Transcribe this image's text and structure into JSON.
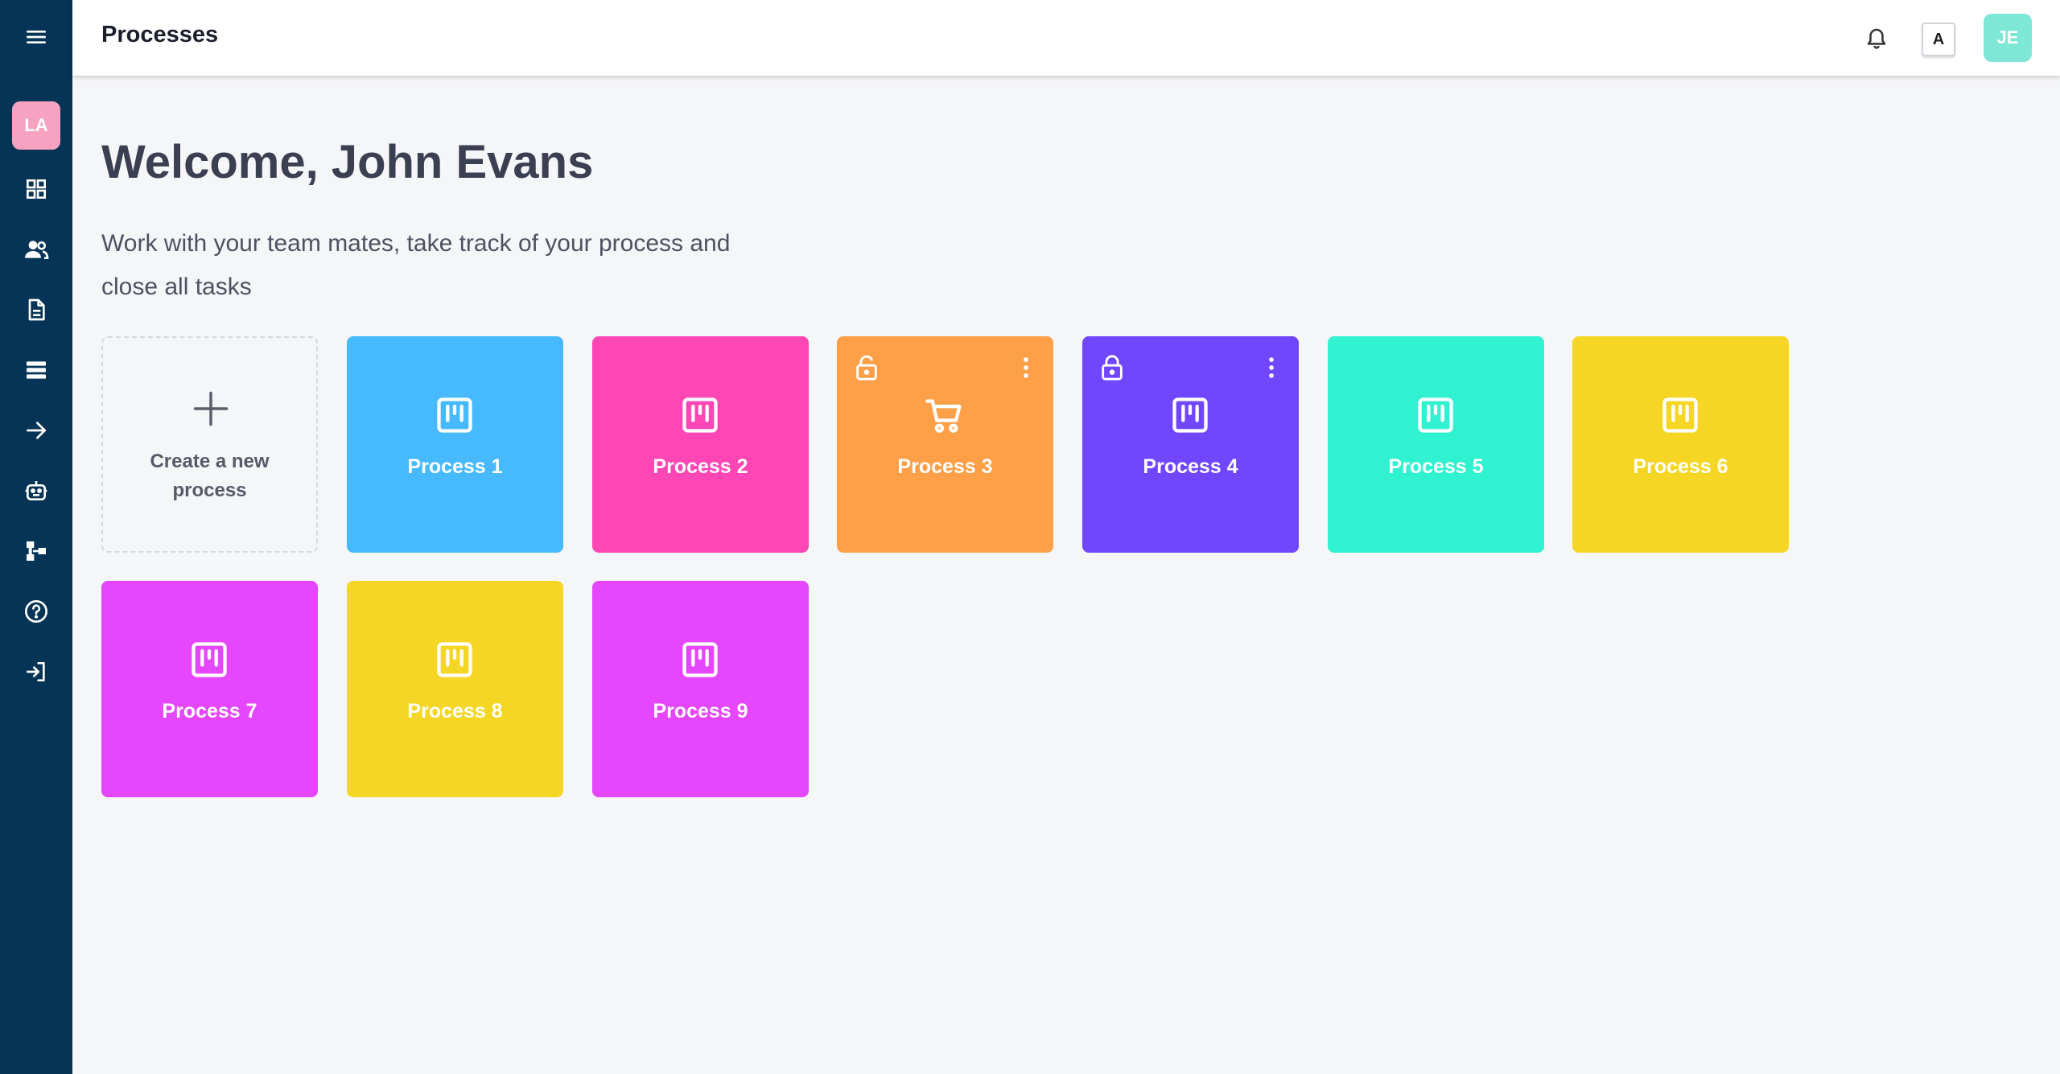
{
  "sidebar": {
    "org_initials": "LA",
    "items": [
      {
        "name": "menu"
      },
      {
        "name": "dashboard"
      },
      {
        "name": "users"
      },
      {
        "name": "documents"
      },
      {
        "name": "database"
      },
      {
        "name": "integrations"
      },
      {
        "name": "robot"
      },
      {
        "name": "workflow"
      },
      {
        "name": "help"
      },
      {
        "name": "logout"
      }
    ]
  },
  "header": {
    "title": "Processes",
    "language": "A",
    "user_initials": "JE"
  },
  "main": {
    "welcome": "Welcome, John Evans",
    "subtitle_line1": "Work with your team mates, take track of your process and",
    "subtitle_line2": "close all tasks",
    "create_line1": "Create a new",
    "create_line2": "process"
  },
  "processes": [
    {
      "label": "Process 1",
      "color": "#47b9ff",
      "icon": "board-icon",
      "locked": false
    },
    {
      "label": "Process 2",
      "color": "#ff46b5",
      "icon": "board-icon",
      "locked": false
    },
    {
      "label": "Process 3",
      "color": "#ff9f47",
      "icon": "cart-icon",
      "locked": true
    },
    {
      "label": "Process 4",
      "color": "#7047ff",
      "icon": "board-icon",
      "locked": true
    },
    {
      "label": "Process 5",
      "color": "#30f2d0",
      "icon": "board-icon",
      "locked": false
    },
    {
      "label": "Process 6",
      "color": "#f5d624",
      "icon": "board-icon",
      "locked": false
    },
    {
      "label": "Process 7",
      "color": "#e546ff",
      "icon": "board-icon",
      "locked": false
    },
    {
      "label": "Process 8",
      "color": "#f5d624",
      "icon": "board-icon",
      "locked": false
    },
    {
      "label": "Process 9",
      "color": "#e546ff",
      "icon": "board-icon",
      "locked": false
    }
  ]
}
